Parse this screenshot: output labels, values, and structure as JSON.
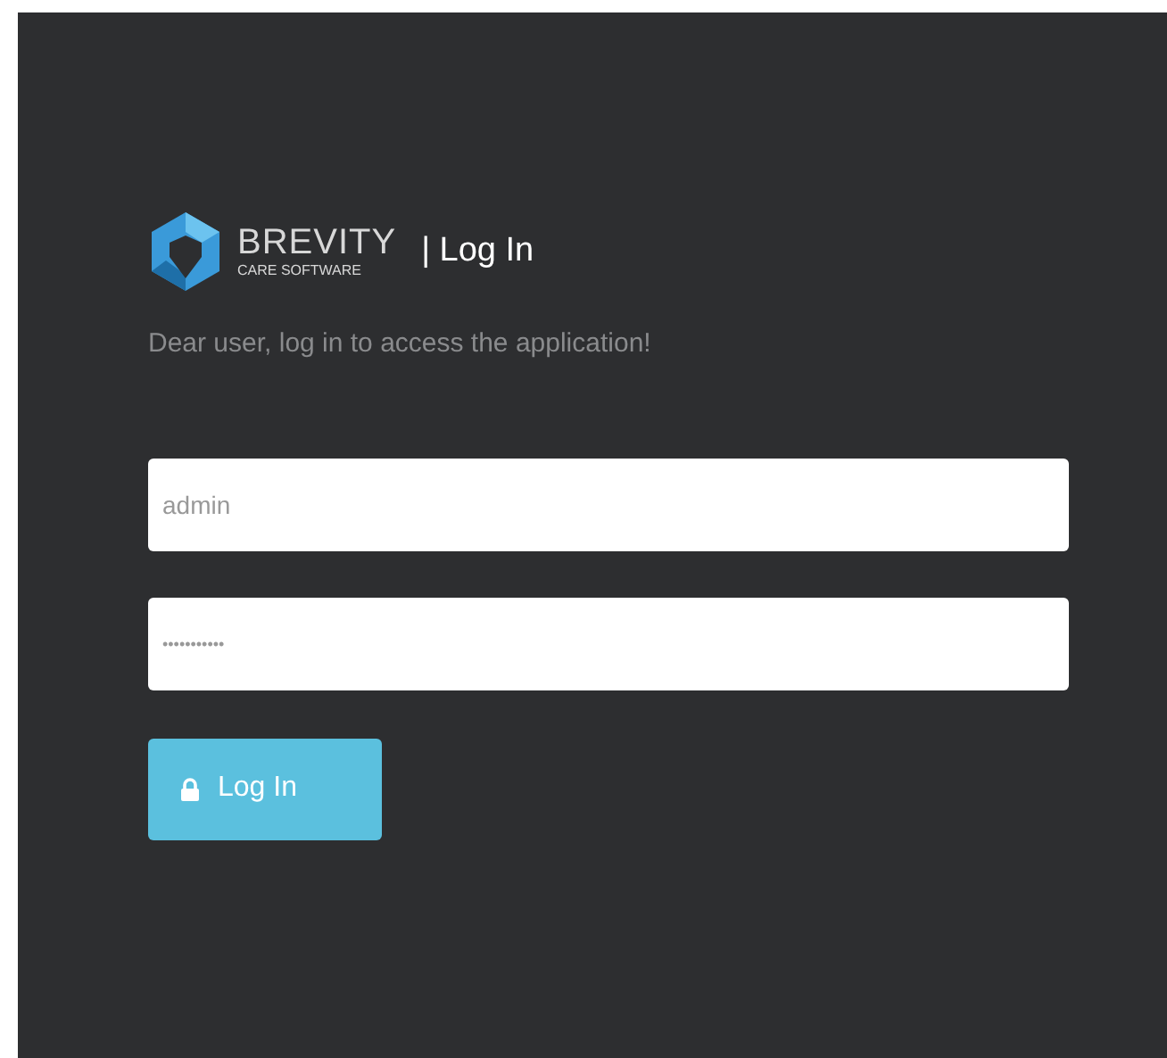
{
  "logo": {
    "name": "BREVITY",
    "tagline": "CARE SOFTWARE"
  },
  "title": "| Log In",
  "subtitle": "Dear user, log in to access the application!",
  "fields": [
    {
      "kind": "text",
      "value": "admin"
    },
    {
      "kind": "password",
      "value": "•••••••••••"
    }
  ],
  "button": {
    "label": "Log In"
  }
}
